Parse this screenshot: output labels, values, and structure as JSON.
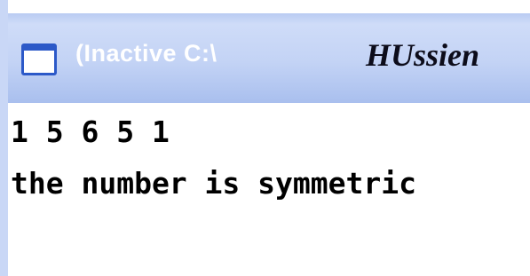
{
  "window": {
    "title": "(Inactive C:\\",
    "title_overlay": "HUssien"
  },
  "console": {
    "lines": [
      "1 5 6 5 1",
      "the number is symmetric"
    ]
  },
  "colors": {
    "titlebar": "#c3d3f5",
    "title_text": "#ffffff",
    "icon_accent": "#2c59c8",
    "console_bg": "#ffffff",
    "console_text": "#000000"
  },
  "icons": {
    "app_icon": "console-window-icon"
  }
}
